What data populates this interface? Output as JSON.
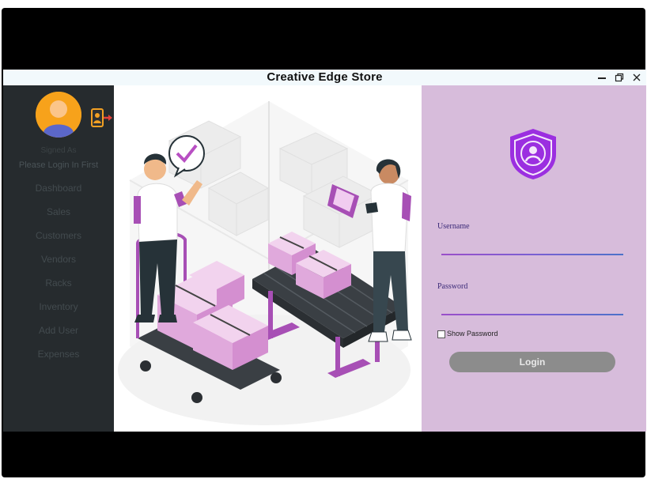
{
  "window": {
    "title": "Creative Edge Store",
    "controls": {
      "minimize": "minimize-icon",
      "restore": "restore-icon",
      "close": "close-icon"
    }
  },
  "sidebar": {
    "signed_as_label": "Signed As",
    "user_name": "Please Login In First",
    "items": [
      {
        "label": "Dashboard"
      },
      {
        "label": "Sales"
      },
      {
        "label": "Customers"
      },
      {
        "label": "Vendors"
      },
      {
        "label": "Racks"
      },
      {
        "label": "Inventory"
      },
      {
        "label": "Add User"
      },
      {
        "label": "Expenses"
      }
    ]
  },
  "login": {
    "username_label": "Username",
    "username_value": "",
    "password_label": "Password",
    "password_value": "",
    "show_password_label": "Show Password",
    "show_password_checked": false,
    "login_button_label": "Login"
  },
  "colors": {
    "sidebar_bg": "#262b2e",
    "login_panel_bg": "#d7bcdb",
    "accent_purple": "#9b2fe0",
    "avatar_orange": "#f7a21b",
    "button_gray": "#8c8c8c"
  }
}
